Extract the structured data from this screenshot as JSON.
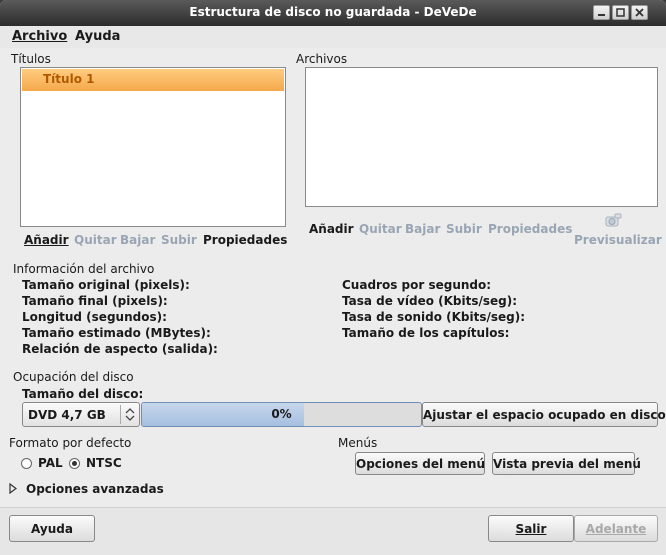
{
  "window": {
    "title": "Estructura de disco no guardada - DeVeDe"
  },
  "menubar": {
    "archivo": "Archivo",
    "ayuda": "Ayuda"
  },
  "titles": {
    "header": "Títulos",
    "items": [
      "Título 1"
    ],
    "actions": {
      "add": "Añadir",
      "remove": "Quitar",
      "down": "Bajar",
      "up": "Subir",
      "properties": "Propiedades"
    }
  },
  "files": {
    "header": "Archivos",
    "actions": {
      "add": "Añadir",
      "remove": "Quitar",
      "down": "Bajar",
      "up": "Subir",
      "properties": "Propiedades",
      "preview": "Previsualizar"
    }
  },
  "file_info": {
    "header": "Información del archivo",
    "left": [
      "Tamaño original (pixels):",
      "Tamaño final (pixels):",
      "Longitud (segundos):",
      "Tamaño estimado (MBytes):",
      "Relación de aspecto (salida):"
    ],
    "right": [
      "Cuadros por segundo:",
      "Tasa de vídeo (Kbits/seg):",
      "Tasa de sonido (Kbits/seg):",
      "Tamaño de los capítulos:"
    ]
  },
  "disc": {
    "header": "Ocupación del disco",
    "size_label": "Tamaño del disco:",
    "size_value": "DVD 4,7 GB",
    "usage_text": "0%",
    "usage_fraction": 0.58,
    "adjust_button": "Ajustar el espacio ocupado en disco"
  },
  "format": {
    "header": "Formato por defecto",
    "pal": "PAL",
    "ntsc": "NTSC",
    "selected": "NTSC"
  },
  "menus": {
    "header": "Menús",
    "options_button": "Opciones del menú",
    "preview_button": "Vista previa del menú"
  },
  "advanced": {
    "label": "Opciones avanzadas"
  },
  "bottom": {
    "help": "Ayuda",
    "exit": "Salir",
    "next": "Adelante"
  }
}
